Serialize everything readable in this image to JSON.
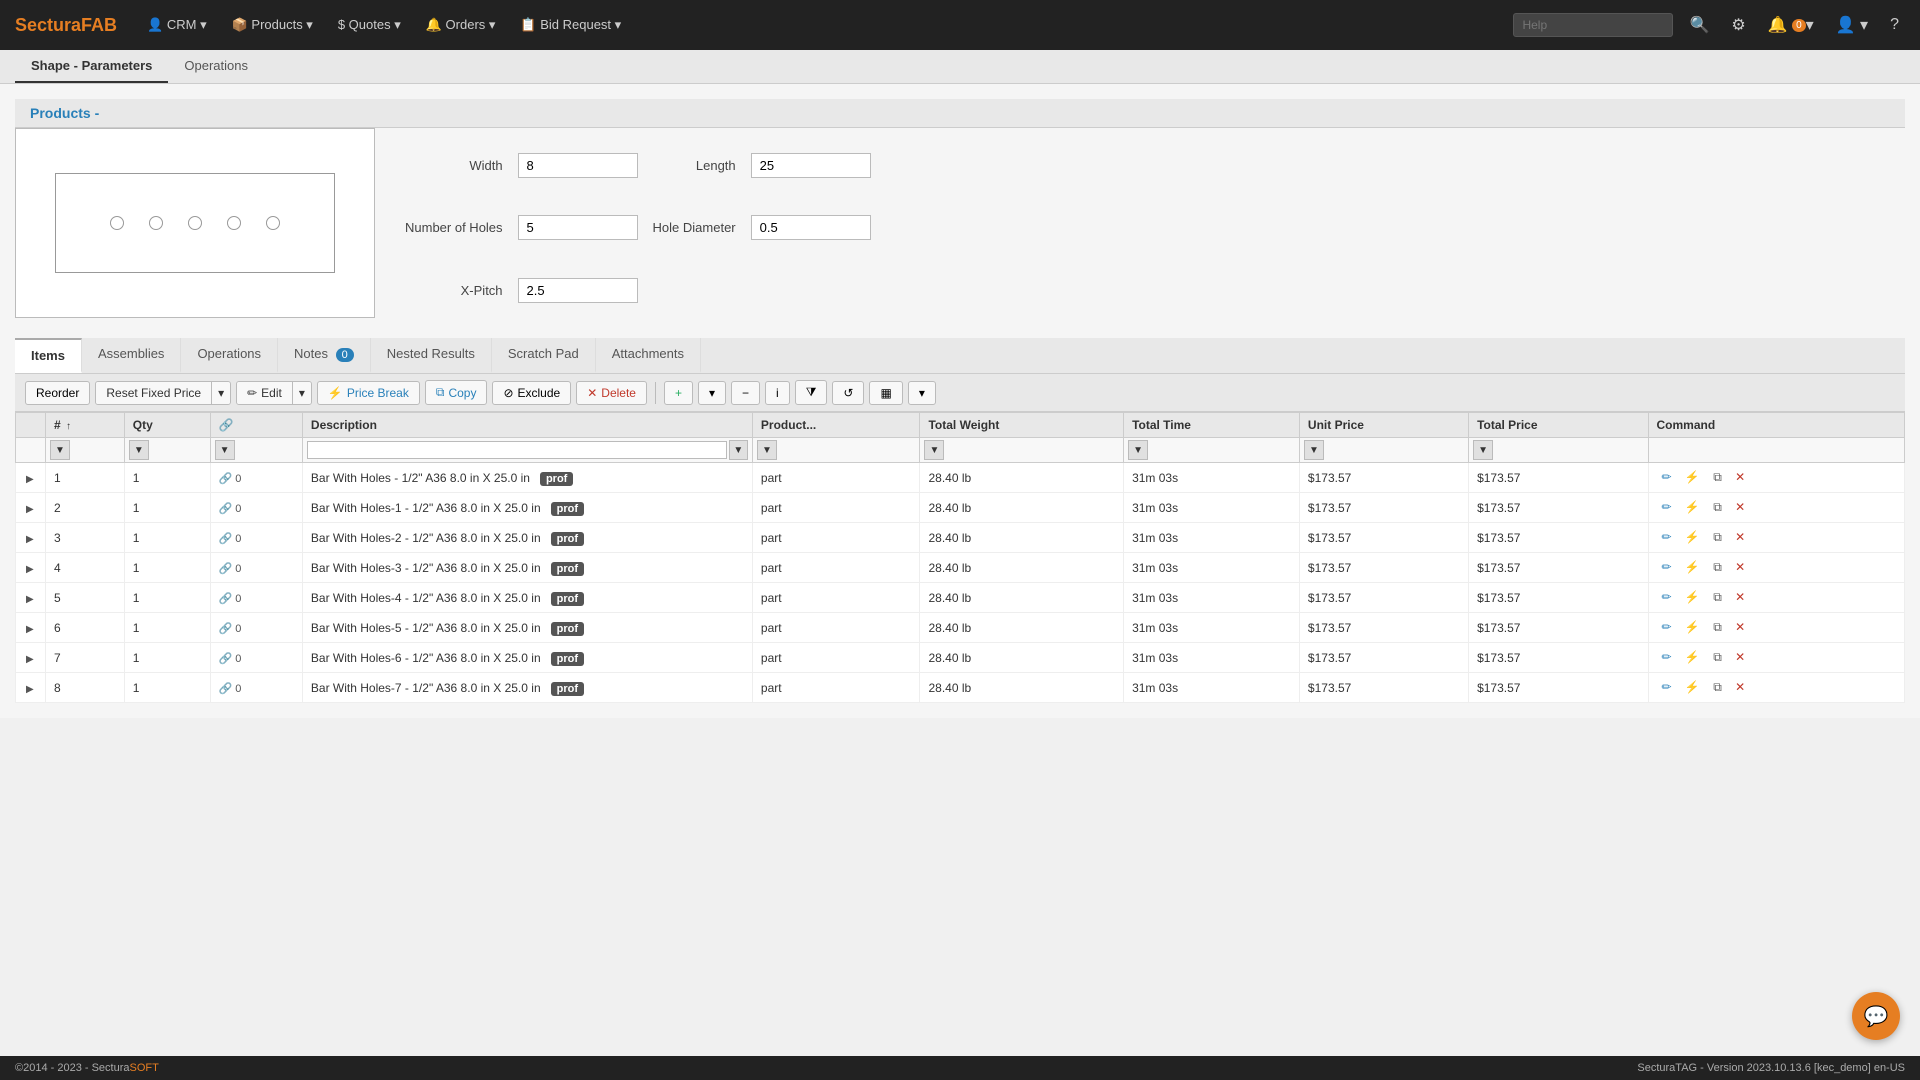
{
  "brand": {
    "prefix": "Sectura",
    "suffix": "FAB"
  },
  "nav": {
    "items": [
      {
        "label": "CRM",
        "icon": "👤",
        "hasDropdown": true
      },
      {
        "label": "Products",
        "icon": "📦",
        "hasDropdown": true
      },
      {
        "label": "Quotes",
        "icon": "$",
        "hasDropdown": true
      },
      {
        "label": "Orders",
        "icon": "🔔",
        "hasDropdown": true
      },
      {
        "label": "Bid Request",
        "icon": "📋",
        "hasDropdown": true
      }
    ],
    "help_placeholder": "Help",
    "notification_count": "0"
  },
  "breadcrumb": "Products -",
  "sub_tabs": [
    {
      "label": "Shape - Parameters",
      "active": true
    },
    {
      "label": "Operations",
      "active": false
    }
  ],
  "shape": {
    "width_label": "Width",
    "width_value": "8",
    "length_label": "Length",
    "length_value": "25",
    "holes_label": "Number of Holes",
    "holes_value": "5",
    "hole_diameter_label": "Hole Diameter",
    "hole_diameter_value": "0.5",
    "xpitch_label": "X-Pitch",
    "xpitch_value": "2.5"
  },
  "bottom_tabs": [
    {
      "label": "Items",
      "active": true,
      "badge": null
    },
    {
      "label": "Assemblies",
      "active": false,
      "badge": null
    },
    {
      "label": "Operations",
      "active": false,
      "badge": null
    },
    {
      "label": "Notes",
      "active": false,
      "badge": "0"
    },
    {
      "label": "Nested Results",
      "active": false,
      "badge": null
    },
    {
      "label": "Scratch Pad",
      "active": false,
      "badge": null
    },
    {
      "label": "Attachments",
      "active": false,
      "badge": null
    }
  ],
  "toolbar": {
    "reorder": "Reorder",
    "reset_fixed_price": "Reset Fixed Price",
    "edit": "Edit",
    "price_break": "Price Break",
    "copy": "Copy",
    "exclude": "Exclude",
    "delete": "Delete"
  },
  "table": {
    "columns": [
      "#",
      "Qty",
      "🔗",
      "Description",
      "Product...",
      "Total Weight",
      "Total Time",
      "Unit Price",
      "Total Price",
      "Command"
    ],
    "rows": [
      {
        "num": 1,
        "qty": 1,
        "links": "0",
        "desc": "Bar With Holes - 1/2\" A36 8.0 in X 25.0 in",
        "prof": "prof",
        "product": "part",
        "weight": "28.40 lb",
        "time": "31m 03s",
        "unit_price": "$173.57",
        "total_price": "$173.57"
      },
      {
        "num": 2,
        "qty": 1,
        "links": "0",
        "desc": "Bar With Holes-1 - 1/2\" A36 8.0 in X 25.0 in",
        "prof": "prof",
        "product": "part",
        "weight": "28.40 lb",
        "time": "31m 03s",
        "unit_price": "$173.57",
        "total_price": "$173.57"
      },
      {
        "num": 3,
        "qty": 1,
        "links": "0",
        "desc": "Bar With Holes-2 - 1/2\" A36 8.0 in X 25.0 in",
        "prof": "prof",
        "product": "part",
        "weight": "28.40 lb",
        "time": "31m 03s",
        "unit_price": "$173.57",
        "total_price": "$173.57"
      },
      {
        "num": 4,
        "qty": 1,
        "links": "0",
        "desc": "Bar With Holes-3 - 1/2\" A36 8.0 in X 25.0 in",
        "prof": "prof",
        "product": "part",
        "weight": "28.40 lb",
        "time": "31m 03s",
        "unit_price": "$173.57",
        "total_price": "$173.57"
      },
      {
        "num": 5,
        "qty": 1,
        "links": "0",
        "desc": "Bar With Holes-4 - 1/2\" A36 8.0 in X 25.0 in",
        "prof": "prof",
        "product": "part",
        "weight": "28.40 lb",
        "time": "31m 03s",
        "unit_price": "$173.57",
        "total_price": "$173.57"
      },
      {
        "num": 6,
        "qty": 1,
        "links": "0",
        "desc": "Bar With Holes-5 - 1/2\" A36 8.0 in X 25.0 in",
        "prof": "prof",
        "product": "part",
        "weight": "28.40 lb",
        "time": "31m 03s",
        "unit_price": "$173.57",
        "total_price": "$173.57"
      },
      {
        "num": 7,
        "qty": 1,
        "links": "0",
        "desc": "Bar With Holes-6 - 1/2\" A36 8.0 in X 25.0 in",
        "prof": "prof",
        "product": "part",
        "weight": "28.40 lb",
        "time": "31m 03s",
        "unit_price": "$173.57",
        "total_price": "$173.57"
      },
      {
        "num": 8,
        "qty": 1,
        "links": "0",
        "desc": "Bar With Holes-7 - 1/2\" A36 8.0 in X 25.0 in",
        "prof": "prof",
        "product": "part",
        "weight": "28.40 lb",
        "time": "31m 03s",
        "unit_price": "$173.57",
        "total_price": "$173.57"
      }
    ]
  },
  "footer": {
    "copyright": "©2014 - 2023 - Sectura",
    "copyright_suffix": "SOFT",
    "version": "SecturaTAG - Version 2023.10.13.6 [kec_demo] en-US"
  }
}
